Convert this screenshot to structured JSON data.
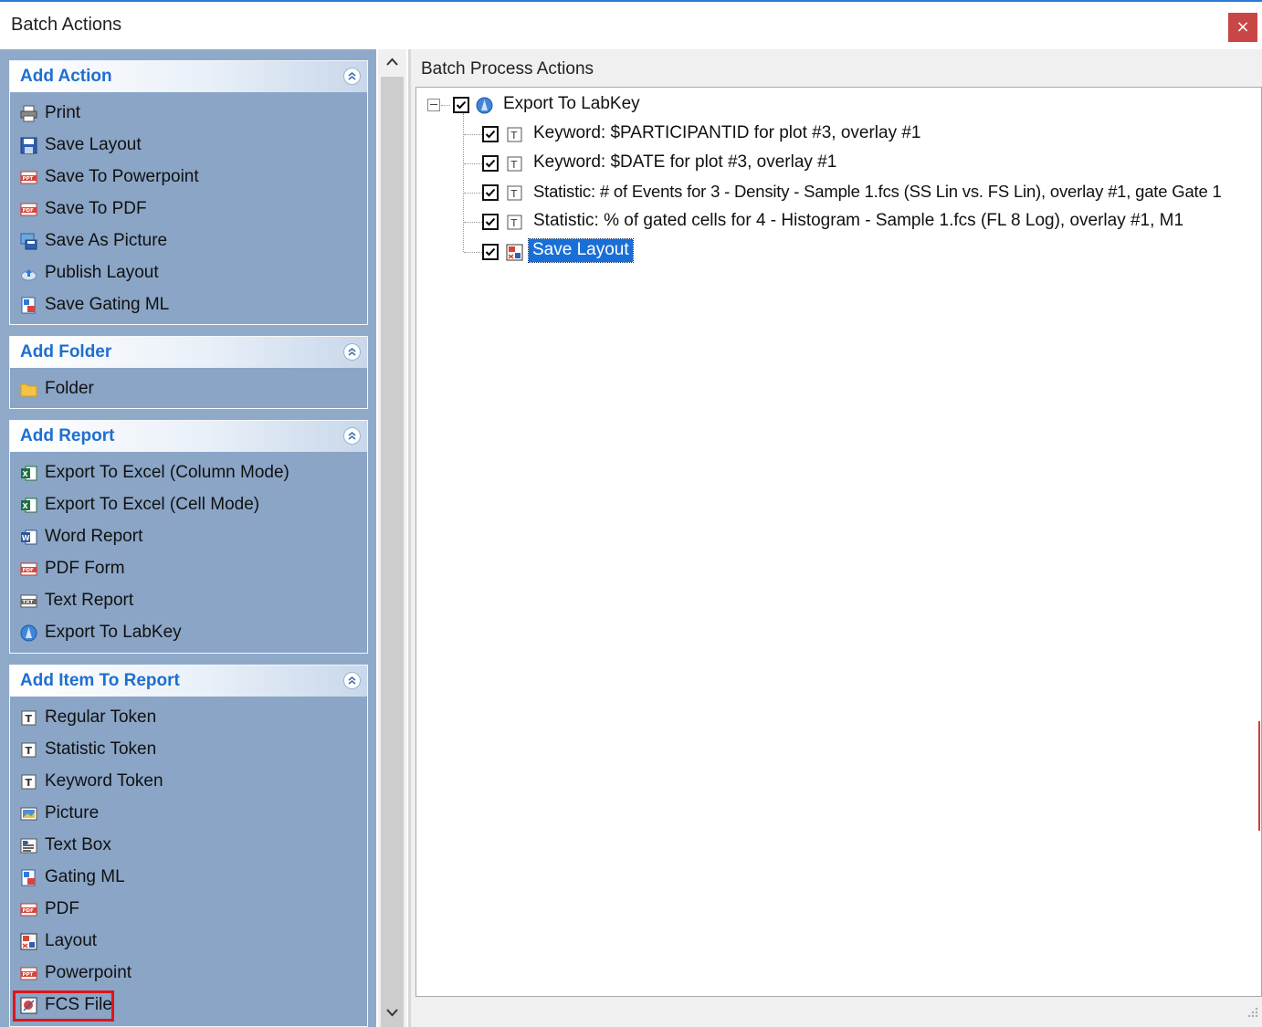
{
  "window": {
    "title": "Batch Actions",
    "close_glyph": "×"
  },
  "left": {
    "groups": [
      {
        "title": "Add Action",
        "items": [
          {
            "label": "Print",
            "icon": "printer-icon"
          },
          {
            "label": "Save Layout",
            "icon": "floppy-icon"
          },
          {
            "label": "Save To Powerpoint",
            "icon": "ppt-icon"
          },
          {
            "label": "Save To PDF",
            "icon": "pdf-icon"
          },
          {
            "label": "Save As Picture",
            "icon": "picture-save-icon"
          },
          {
            "label": "Publish Layout",
            "icon": "cloud-upload-icon"
          },
          {
            "label": "Save Gating ML",
            "icon": "gating-ml-icon"
          }
        ]
      },
      {
        "title": "Add Folder",
        "items": [
          {
            "label": "Folder",
            "icon": "folder-icon"
          }
        ]
      },
      {
        "title": "Add Report",
        "items": [
          {
            "label": "Export To Excel (Column Mode)",
            "icon": "excel-icon"
          },
          {
            "label": "Export To Excel (Cell Mode)",
            "icon": "excel-icon"
          },
          {
            "label": "Word Report",
            "icon": "word-icon"
          },
          {
            "label": "PDF Form",
            "icon": "pdf-icon"
          },
          {
            "label": "Text Report",
            "icon": "txt-icon"
          },
          {
            "label": "Export To LabKey",
            "icon": "labkey-icon"
          }
        ]
      },
      {
        "title": "Add Item To Report",
        "items": [
          {
            "label": "Regular Token",
            "icon": "token-icon"
          },
          {
            "label": "Statistic Token",
            "icon": "token-icon"
          },
          {
            "label": "Keyword Token",
            "icon": "token-icon"
          },
          {
            "label": "Picture",
            "icon": "picture-icon"
          },
          {
            "label": "Text Box",
            "icon": "textbox-icon"
          },
          {
            "label": "Gating ML",
            "icon": "gating-ml-icon"
          },
          {
            "label": "PDF",
            "icon": "pdf-icon"
          },
          {
            "label": "Layout",
            "icon": "layout-icon"
          },
          {
            "label": "Powerpoint",
            "icon": "ppt-icon"
          },
          {
            "label": "FCS File",
            "icon": "fcs-icon"
          }
        ]
      }
    ]
  },
  "right": {
    "title": "Batch Process Actions",
    "tree": {
      "root": {
        "label": "Export To LabKey",
        "checked": true,
        "expanded": true
      },
      "children": [
        {
          "label": "Keyword: $PARTICIPANTID for plot #3, overlay #1",
          "checked": true,
          "icon": "token-icon"
        },
        {
          "label": "Keyword: $DATE for plot #3, overlay #1",
          "checked": true,
          "icon": "token-icon"
        },
        {
          "label": "Statistic: # of Events for 3 - Density - Sample 1.fcs (SS Lin vs. FS Lin), overlay #1, gate Gate 1",
          "checked": true,
          "icon": "token-icon"
        },
        {
          "label": "Statistic: % of gated cells for 4 - Histogram - Sample 1.fcs (FL 8 Log), overlay #1, M1",
          "checked": true,
          "icon": "token-icon"
        },
        {
          "label": "Save Layout",
          "checked": true,
          "icon": "layout-icon",
          "selected": true
        }
      ]
    }
  },
  "colors": {
    "accent_title": "#1e6fd0",
    "panel_bg": "#8fa9c9",
    "selection": "#1a6fd6",
    "highlight_box": "#e0141a",
    "close_button": "#c94646"
  }
}
